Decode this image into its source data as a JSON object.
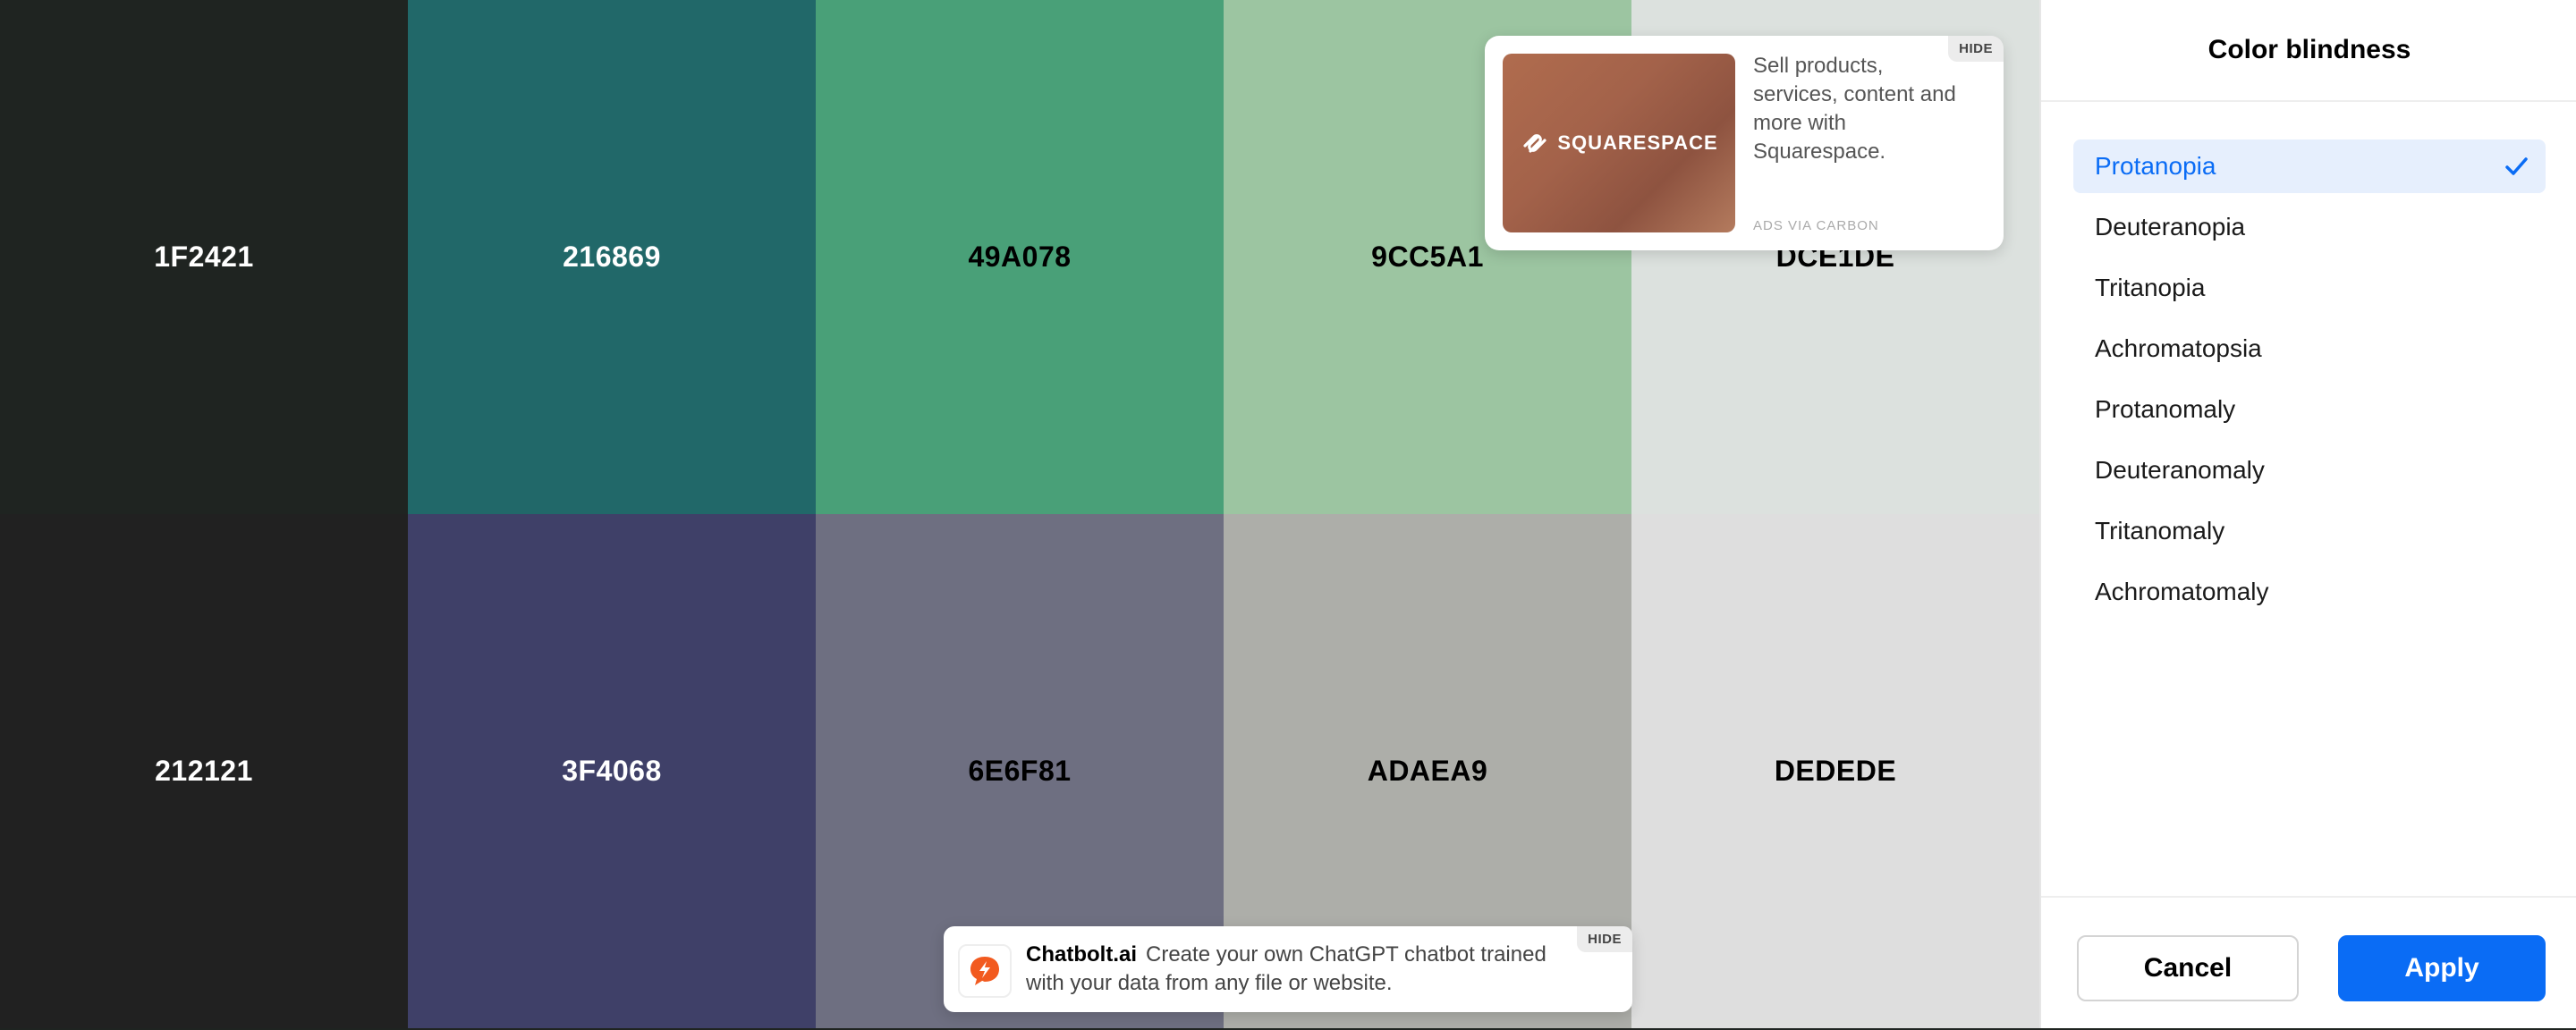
{
  "palette": {
    "row1": [
      {
        "hex": "1F2421",
        "color": "#1F2421",
        "text_style": "light"
      },
      {
        "hex": "216869",
        "color": "#216869",
        "text_style": "light"
      },
      {
        "hex": "49A078",
        "color": "#49A078",
        "text_style": "dark"
      },
      {
        "hex": "9CC5A1",
        "color": "#9CC5A1",
        "text_style": "dark"
      },
      {
        "hex": "DCE1DE",
        "color": "#DCE1DE",
        "text_style": "dark"
      }
    ],
    "row2": [
      {
        "hex": "212121",
        "color": "#212121",
        "text_style": "light"
      },
      {
        "hex": "3F4068",
        "color": "#3F4068",
        "text_style": "light"
      },
      {
        "hex": "6E6F81",
        "color": "#6E6F81",
        "text_style": "dark"
      },
      {
        "hex": "ADAEA9",
        "color": "#ADAEA9",
        "text_style": "dark"
      },
      {
        "hex": "DEDEDE",
        "color": "#DEDEDE",
        "text_style": "dark"
      }
    ]
  },
  "ad_card": {
    "brand": "SQUARESPACE",
    "text": "Sell products, services, content and more with Squarespace.",
    "via": "ADS VIA CARBON",
    "hide_label": "HIDE"
  },
  "ad_bar": {
    "brand": "Chatbolt.ai",
    "text": "Create your own ChatGPT chatbot trained with your data from any file or website.",
    "hide_label": "HIDE",
    "logo_icon": "chat-bolt-icon"
  },
  "panel": {
    "title": "Color blindness",
    "options": [
      {
        "label": "Protanopia",
        "selected": true
      },
      {
        "label": "Deuteranopia",
        "selected": false
      },
      {
        "label": "Tritanopia",
        "selected": false
      },
      {
        "label": "Achromatopsia",
        "selected": false
      },
      {
        "label": "Protanomaly",
        "selected": false
      },
      {
        "label": "Deuteranomaly",
        "selected": false
      },
      {
        "label": "Tritanomaly",
        "selected": false
      },
      {
        "label": "Achromatomaly",
        "selected": false
      }
    ],
    "cancel_label": "Cancel",
    "apply_label": "Apply",
    "accent_color": "#0A6CF5",
    "selected_bg": "#E6EFFD"
  }
}
